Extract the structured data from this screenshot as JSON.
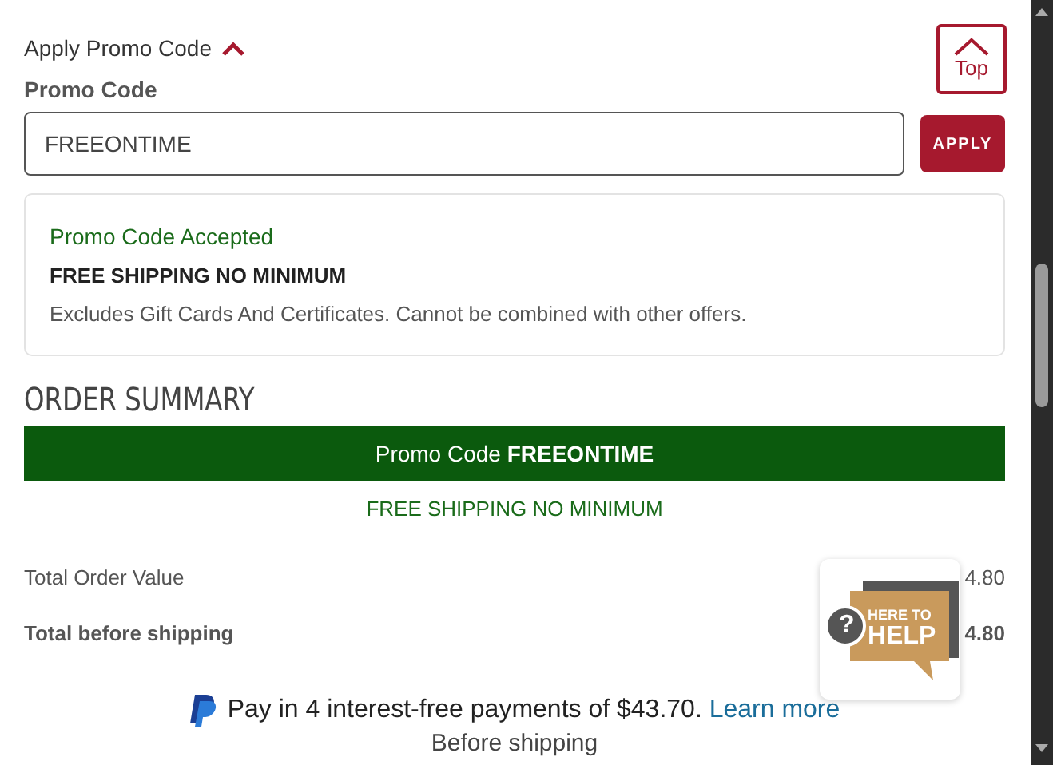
{
  "promo_toggle": {
    "label": "Apply Promo Code",
    "expanded": true
  },
  "top_button": {
    "label": "Top"
  },
  "promo_field": {
    "label": "Promo Code",
    "value": "FREEONTIME"
  },
  "apply_button": {
    "label": "APPLY"
  },
  "promo_message": {
    "status": "Promo Code Accepted",
    "title": "FREE SHIPPING NO MINIMUM",
    "detail": "Excludes Gift Cards And Certificates. Cannot be combined with other offers."
  },
  "order_summary": {
    "heading": "ORDER SUMMARY",
    "banner": "Promo Code **FREEONTIME**",
    "promo_note": "FREE SHIPPING NO MINIMUM",
    "rows": [
      {
        "label": "Total Order Value",
        "value": "4.80",
        "bold": false
      },
      {
        "label": "Total before shipping",
        "value": "4.80",
        "bold": true
      }
    ]
  },
  "help_widget": {
    "icon": "?",
    "line_1": "HERE TO",
    "line_2": "HELP"
  },
  "paypal": {
    "text": "Pay in 4 interest-free payments of $43.70.",
    "link": "Learn more",
    "note": "Before shipping"
  }
}
